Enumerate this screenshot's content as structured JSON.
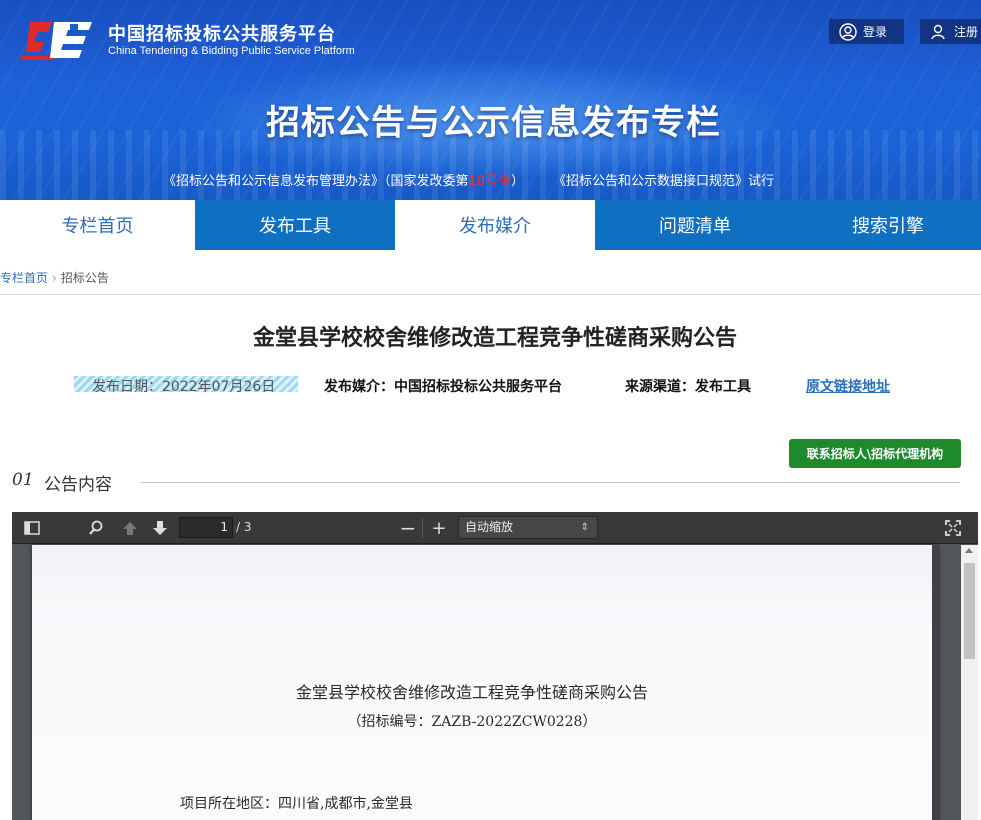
{
  "header": {
    "site_name": "中国招标投标公共服务平台",
    "site_name_en": "China Tendering & Bidding Public Service Platform",
    "login_label": "登录",
    "register_label": "注册",
    "banner_title": "招标公告与公示信息发布专栏",
    "notice_part1": "《招标公告和公示信息发布管理办法》（国家发改委第",
    "notice_red": "10号令",
    "notice_part2": "）       《招标公告和公示数据接口规范》试行"
  },
  "nav": {
    "items": [
      {
        "label": "专栏首页"
      },
      {
        "label": "发布工具"
      },
      {
        "label": "发布媒介"
      },
      {
        "label": "问题清单"
      },
      {
        "label": "搜索引擎"
      }
    ]
  },
  "breadcrumb": {
    "home": "专栏首页",
    "current": "招标公告"
  },
  "article": {
    "title": "金堂县学校校舍维修改造工程竞争性磋商采购公告",
    "publish_date": "发布日期：2022年07月26日",
    "media": "发布媒介：中国招标投标公共服务平台",
    "channel": "来源渠道：发布工具",
    "original_link": "原文链接地址",
    "contact_button": "联系招标人\\招标代理机构",
    "section_number": "01",
    "section_label": "公告内容"
  },
  "pdf_viewer": {
    "current_page": "1",
    "total_pages": "/ 3",
    "zoom_label": "自动缩放",
    "page_title": "金堂县学校校舍维修改造工程竞争性磋商采购公告",
    "page_doc_no": "（招标编号：ZAZB-2022ZCW0228）",
    "page_region": "项目所在地区：四川省,成都市,金堂县"
  }
}
